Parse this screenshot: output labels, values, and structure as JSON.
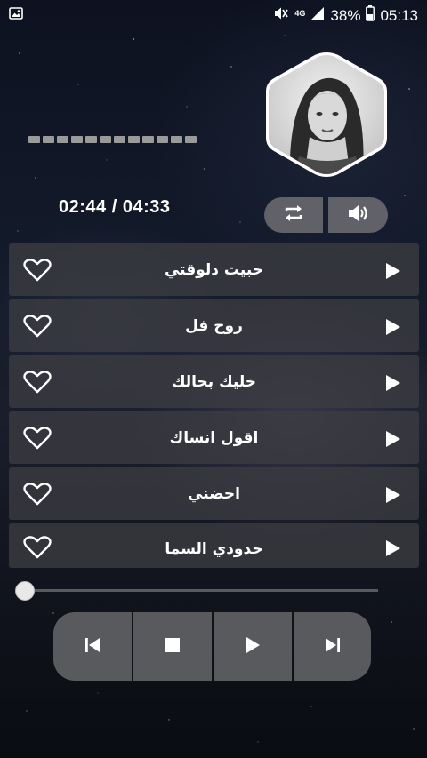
{
  "status_bar": {
    "battery": "38%",
    "time": "05:13",
    "network": "4G"
  },
  "player": {
    "time_display": "02:44 / 04:33",
    "seek_position": 0.0
  },
  "tracks": [
    {
      "title": "حبيت دلوقتي"
    },
    {
      "title": "روح فل"
    },
    {
      "title": "خليك بحالك"
    },
    {
      "title": "اقول انساك"
    },
    {
      "title": "احضني"
    },
    {
      "title": "حدودي السما"
    }
  ],
  "icons": {
    "repeat": "repeat-icon",
    "volume": "volume-icon",
    "favorite": "heart-outline-icon",
    "play": "play-icon",
    "previous": "skip-previous-icon",
    "stop": "stop-icon",
    "next": "skip-next-icon"
  },
  "colors": {
    "row_bg": "#3c3c41",
    "button_bg": "#6e6e73",
    "text": "#ffffff"
  }
}
